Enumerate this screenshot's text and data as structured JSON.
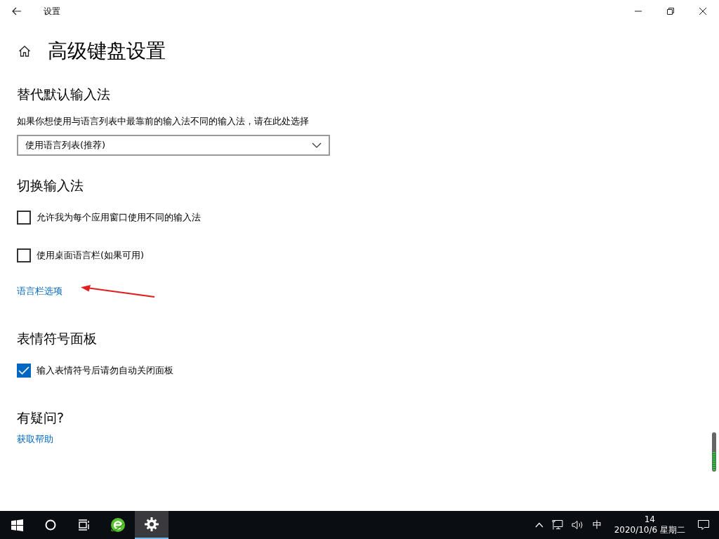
{
  "window": {
    "title": "设置"
  },
  "page": {
    "title": "高级键盘设置"
  },
  "sections": [
    {
      "heading": "替代默认输入法",
      "items": [
        {
          "kind": "text",
          "text": "如果你想使用与语言列表中最靠前的输入法不同的输入法，请在此处选择"
        },
        {
          "kind": "dropdown",
          "value": "使用语言列表(推荐)"
        }
      ]
    },
    {
      "heading": "切换输入法",
      "items": [
        {
          "kind": "checkbox",
          "label": "允许我为每个应用窗口使用不同的输入法",
          "checked": false
        },
        {
          "kind": "checkbox",
          "label": "使用桌面语言栏(如果可用)",
          "checked": false
        },
        {
          "kind": "link",
          "text": "语言栏选项",
          "annotated": true
        }
      ]
    },
    {
      "heading": "表情符号面板",
      "items": [
        {
          "kind": "checkbox",
          "label": "输入表情符号后请勿自动关闭面板",
          "checked": true
        }
      ]
    },
    {
      "heading": "有疑问?",
      "items": [
        {
          "kind": "link",
          "text": "获取帮助",
          "annotated": false
        }
      ]
    }
  ],
  "taskbar": {
    "tray_language": "中",
    "time": "14",
    "date": "2020/10/6 星期二"
  }
}
